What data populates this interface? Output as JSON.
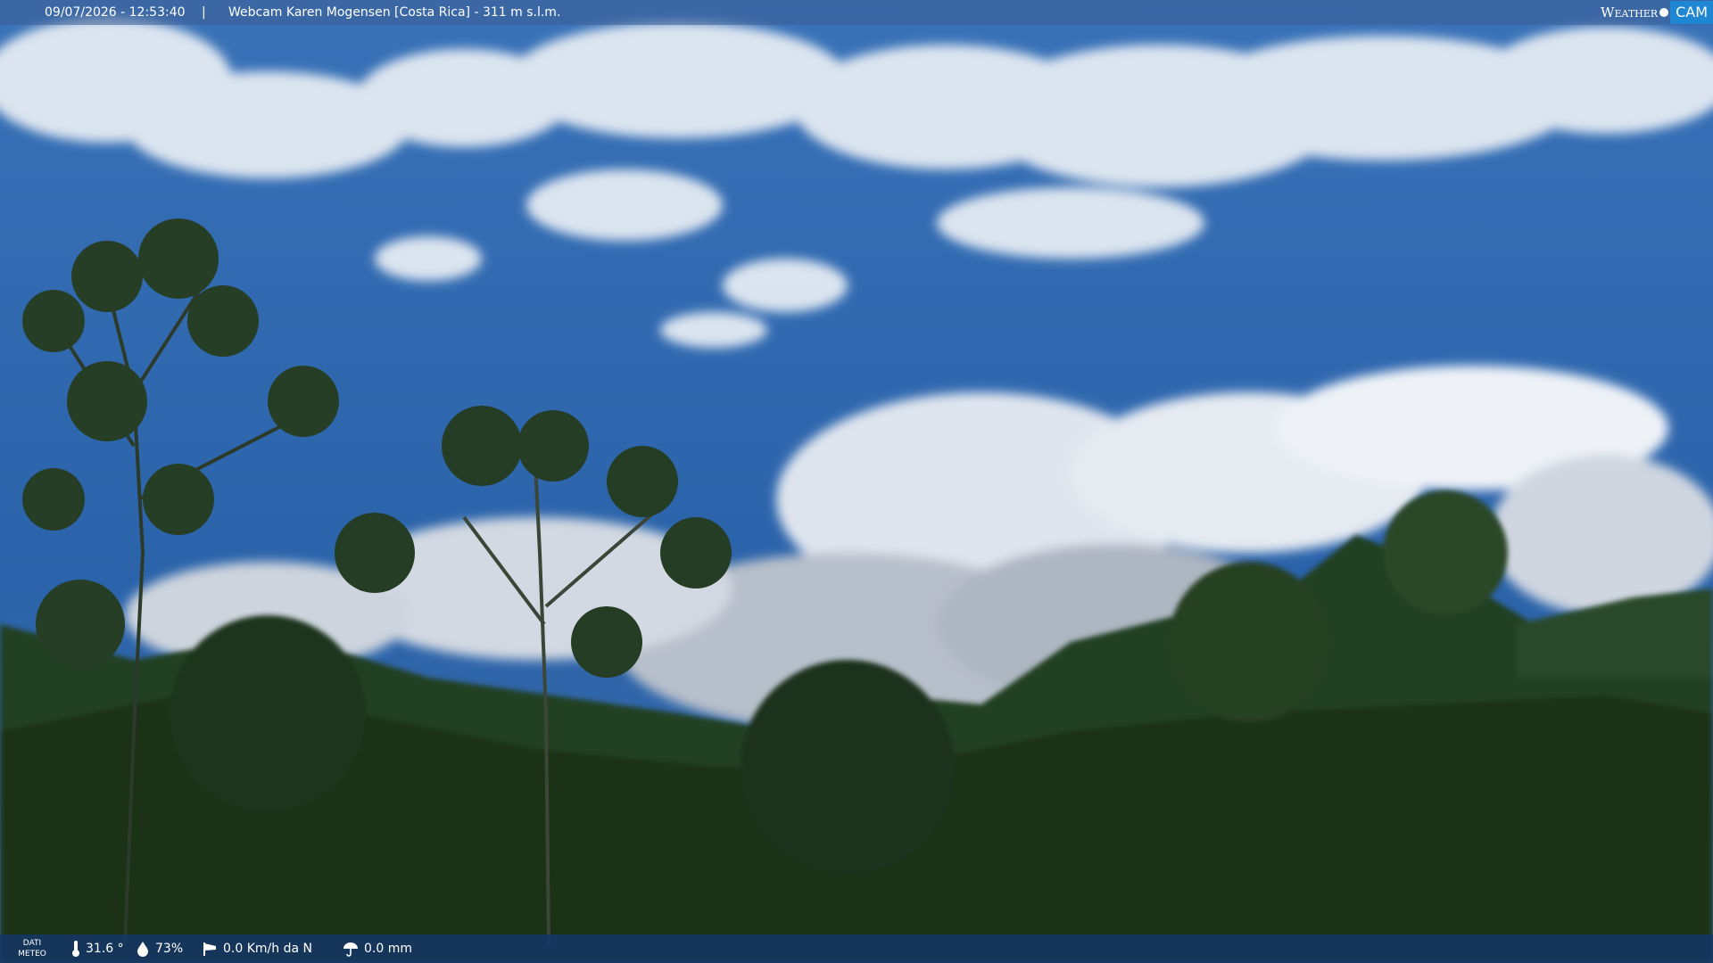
{
  "overlay": {
    "timestamp": "09/07/2026 - 12:53:40",
    "separator": "|",
    "title": "Webcam Karen Mogensen [Costa Rica]  - 311 m s.l.m."
  },
  "logo": {
    "weather": "Weather",
    "cam": "CAM"
  },
  "meteo": {
    "label_line1": "DATI",
    "label_line2": "METEO",
    "temperature": "31.6 °",
    "humidity": "73%",
    "wind": "0.0 Km/h da N",
    "rain": "0.0 mm"
  },
  "icons": {
    "temperature": "thermometer-icon",
    "humidity": "droplet-icon",
    "wind": "windsock-icon",
    "rain": "umbrella-icon"
  },
  "colors": {
    "sky": "#2c66ad",
    "forest": "#1e3a1c",
    "logo_accent": "#1f86d4"
  }
}
